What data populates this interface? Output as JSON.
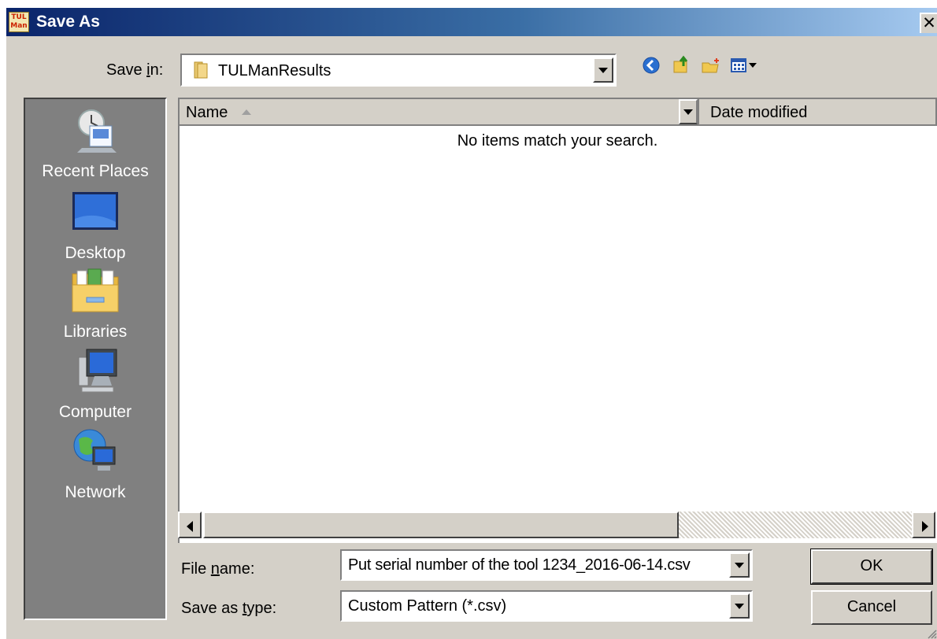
{
  "window": {
    "title": "Save As",
    "app_icon_text": "TUL Man"
  },
  "toolbar": {
    "save_in_label": "Save in:",
    "save_in_mnemonic": "i",
    "location": "TULManResults",
    "icons": [
      "back-icon",
      "up-folder-icon",
      "new-folder-icon",
      "view-menu-icon"
    ]
  },
  "places": [
    {
      "id": "recent",
      "label": "Recent Places",
      "icon": "recent-places-icon"
    },
    {
      "id": "desktop",
      "label": "Desktop",
      "icon": "desktop-icon"
    },
    {
      "id": "libraries",
      "label": "Libraries",
      "icon": "libraries-icon"
    },
    {
      "id": "computer",
      "label": "Computer",
      "icon": "computer-icon"
    },
    {
      "id": "network",
      "label": "Network",
      "icon": "network-icon"
    }
  ],
  "filelist": {
    "columns": [
      "Name",
      "Date modified"
    ],
    "empty_message": "No items match your search."
  },
  "form": {
    "file_name_label": "File name:",
    "file_name_mnemonic": "n",
    "file_name_value": "Put serial number of the tool 1234_2016-06-14.csv",
    "save_type_label": "Save as type:",
    "save_type_mnemonic": "t",
    "save_type_value": "Custom Pattern (*.csv)"
  },
  "buttons": {
    "ok": "OK",
    "cancel": "Cancel"
  },
  "colors": {
    "title_start": "#0a246a",
    "title_end": "#a6caf0",
    "face": "#d4d0c8",
    "places_bg": "#808080"
  }
}
